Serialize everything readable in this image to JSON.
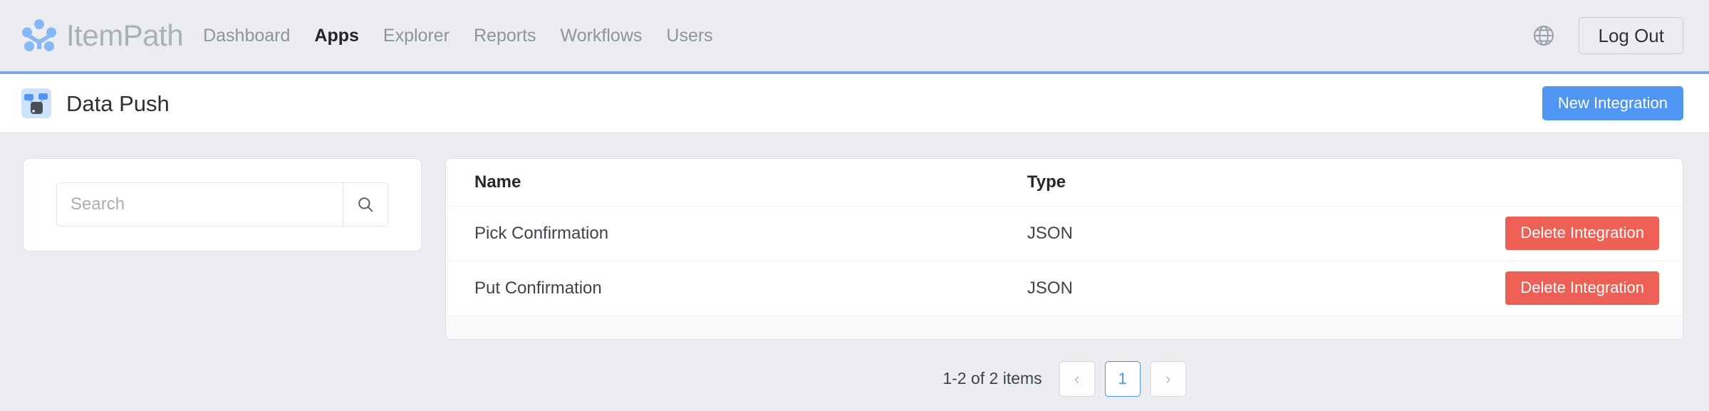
{
  "header": {
    "logo_icon": "itempath-dots-logo-icon",
    "brand": "ItemPath",
    "nav": [
      {
        "label": "Dashboard",
        "active": false
      },
      {
        "label": "Apps",
        "active": true
      },
      {
        "label": "Explorer",
        "active": false
      },
      {
        "label": "Reports",
        "active": false
      },
      {
        "label": "Workflows",
        "active": false
      },
      {
        "label": "Users",
        "active": false
      }
    ],
    "language_icon": "globe-icon",
    "logout_label": "Log Out",
    "accent_color": "#7ea7ee"
  },
  "titlebar": {
    "app_icon": "data-push-app-icon",
    "title": "Data Push",
    "new_integration_label": "New Integration",
    "new_integration_color": "#4f96f2"
  },
  "search": {
    "placeholder": "Search",
    "value": "",
    "search_icon": "magnifier-icon"
  },
  "table": {
    "columns": [
      "Name",
      "Type",
      ""
    ],
    "rows": [
      {
        "name": "Pick Confirmation",
        "type": "JSON",
        "action": "Delete Integration"
      },
      {
        "name": "Put Confirmation",
        "type": "JSON",
        "action": "Delete Integration"
      }
    ],
    "delete_color": "#ee6055"
  },
  "pagination": {
    "info": "1-2 of 2 items",
    "prev": "‹",
    "pages": [
      "1"
    ],
    "current_page": "1",
    "next": "›"
  }
}
